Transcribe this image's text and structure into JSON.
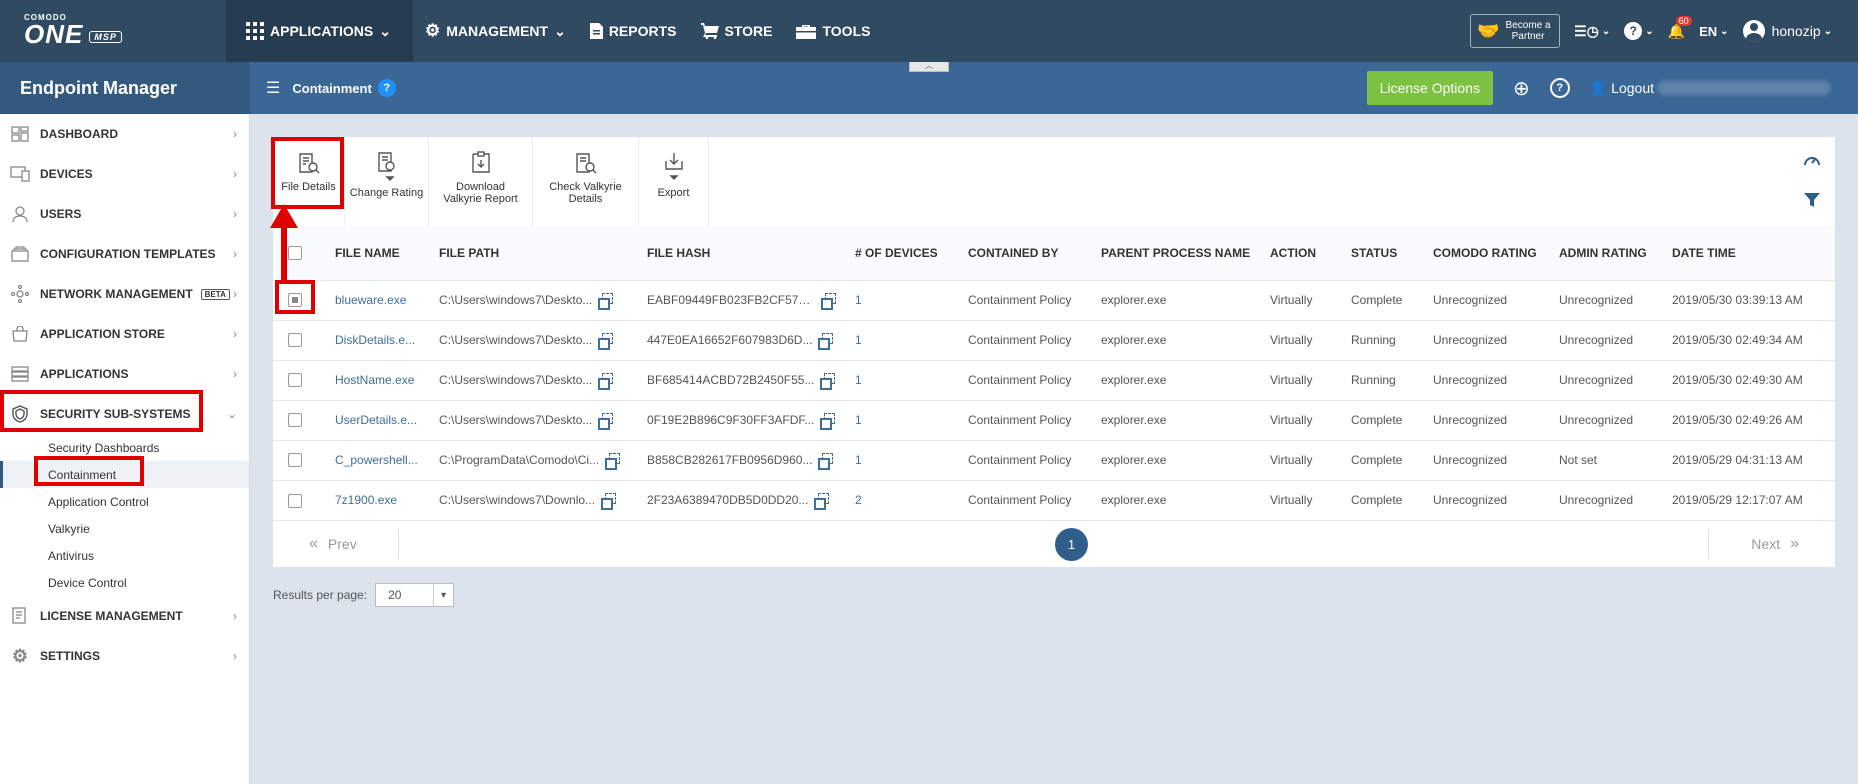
{
  "brand": {
    "small": "COMODO",
    "big": "ONE",
    "msp": "MSP"
  },
  "topnav": [
    {
      "label": "APPLICATIONS",
      "icon": "grid-icon"
    },
    {
      "label": "MANAGEMENT",
      "icon": "gear-icon"
    },
    {
      "label": "REPORTS",
      "icon": "report-icon"
    },
    {
      "label": "STORE",
      "icon": "cart-icon"
    },
    {
      "label": "TOOLS",
      "icon": "toolbox-icon"
    }
  ],
  "topright": {
    "partner_line1": "Become a",
    "partner_line2": "Partner",
    "notifications": "60",
    "language": "EN",
    "username": "honozip"
  },
  "subbar": {
    "module": "Endpoint Manager",
    "breadcrumb": "Containment",
    "help": "?",
    "license_button": "License Options",
    "logout": "Logout"
  },
  "sidebar": {
    "items": [
      {
        "label": "DASHBOARD"
      },
      {
        "label": "DEVICES"
      },
      {
        "label": "USERS"
      },
      {
        "label": "CONFIGURATION TEMPLATES"
      },
      {
        "label": "NETWORK MANAGEMENT",
        "badge": "BETA"
      },
      {
        "label": "APPLICATION STORE"
      },
      {
        "label": "APPLICATIONS"
      },
      {
        "label": "SECURITY SUB-SYSTEMS"
      }
    ],
    "subitems": [
      "Security Dashboards",
      "Containment",
      "Application Control",
      "Valkyrie",
      "Antivirus",
      "Device Control"
    ],
    "bottom": [
      {
        "label": "LICENSE MANAGEMENT"
      },
      {
        "label": "SETTINGS"
      }
    ]
  },
  "toolbar": {
    "file_details": "File Details",
    "change_rating": "Change Rating",
    "download_l1": "Download",
    "download_l2": "Valkyrie Report",
    "check_l1": "Check Valkyrie",
    "check_l2": "Details",
    "export": "Export"
  },
  "table": {
    "headers": [
      "FILE NAME",
      "FILE PATH",
      "FILE HASH",
      "# OF DEVICES",
      "CONTAINED BY",
      "PARENT PROCESS NAME",
      "ACTION",
      "STATUS",
      "COMODO RATING",
      "ADMIN RATING",
      "DATE TIME"
    ],
    "rows": [
      {
        "name": "blueware.exe",
        "path": "C:\\Users\\windows7\\Deskto...",
        "hash": "EABF09449FB023FB2CF57A...",
        "devices": "1",
        "contained": "Containment Policy",
        "parent": "explorer.exe",
        "action": "Virtually",
        "status": "Complete",
        "comodo": "Unrecognized",
        "admin": "Unrecognized",
        "date": "2019/05/30 03:39:13 AM"
      },
      {
        "name": "DiskDetails.e...",
        "path": "C:\\Users\\windows7\\Deskto...",
        "hash": "447E0EA16652F607983D6D...",
        "devices": "1",
        "contained": "Containment Policy",
        "parent": "explorer.exe",
        "action": "Virtually",
        "status": "Running",
        "comodo": "Unrecognized",
        "admin": "Unrecognized",
        "date": "2019/05/30 02:49:34 AM"
      },
      {
        "name": "HostName.exe",
        "path": "C:\\Users\\windows7\\Deskto...",
        "hash": "BF685414ACBD72B2450F55...",
        "devices": "1",
        "contained": "Containment Policy",
        "parent": "explorer.exe",
        "action": "Virtually",
        "status": "Running",
        "comodo": "Unrecognized",
        "admin": "Unrecognized",
        "date": "2019/05/30 02:49:30 AM"
      },
      {
        "name": "UserDetails.e...",
        "path": "C:\\Users\\windows7\\Deskto...",
        "hash": "0F19E2B896C9F30FF3AFDF...",
        "devices": "1",
        "contained": "Containment Policy",
        "parent": "explorer.exe",
        "action": "Virtually",
        "status": "Complete",
        "comodo": "Unrecognized",
        "admin": "Unrecognized",
        "date": "2019/05/30 02:49:26 AM"
      },
      {
        "name": "C_powershell...",
        "path": "C:\\ProgramData\\Comodo\\Ci...",
        "hash": "B858CB282617FB0956D960...",
        "devices": "1",
        "contained": "Containment Policy",
        "parent": "explorer.exe",
        "action": "Virtually",
        "status": "Complete",
        "comodo": "Unrecognized",
        "admin": "Not set",
        "date": "2019/05/29 04:31:13 AM"
      },
      {
        "name": "7z1900.exe",
        "path": "C:\\Users\\windows7\\Downlo...",
        "hash": "2F23A6389470DB5D0DD20...",
        "devices": "2",
        "contained": "Containment Policy",
        "parent": "explorer.exe",
        "action": "Virtually",
        "status": "Complete",
        "comodo": "Unrecognized",
        "admin": "Unrecognized",
        "date": "2019/05/29 12:17:07 AM"
      }
    ]
  },
  "pager": {
    "prev": "Prev",
    "next": "Next",
    "page": "1"
  },
  "per_page": {
    "label": "Results per page:",
    "value": "20"
  },
  "colors": {
    "topbar": "#2f4a61",
    "subbar": "#3a6795",
    "accent_green": "#7cc142",
    "highlight_red": "#e00000",
    "link": "#3d6f99"
  }
}
